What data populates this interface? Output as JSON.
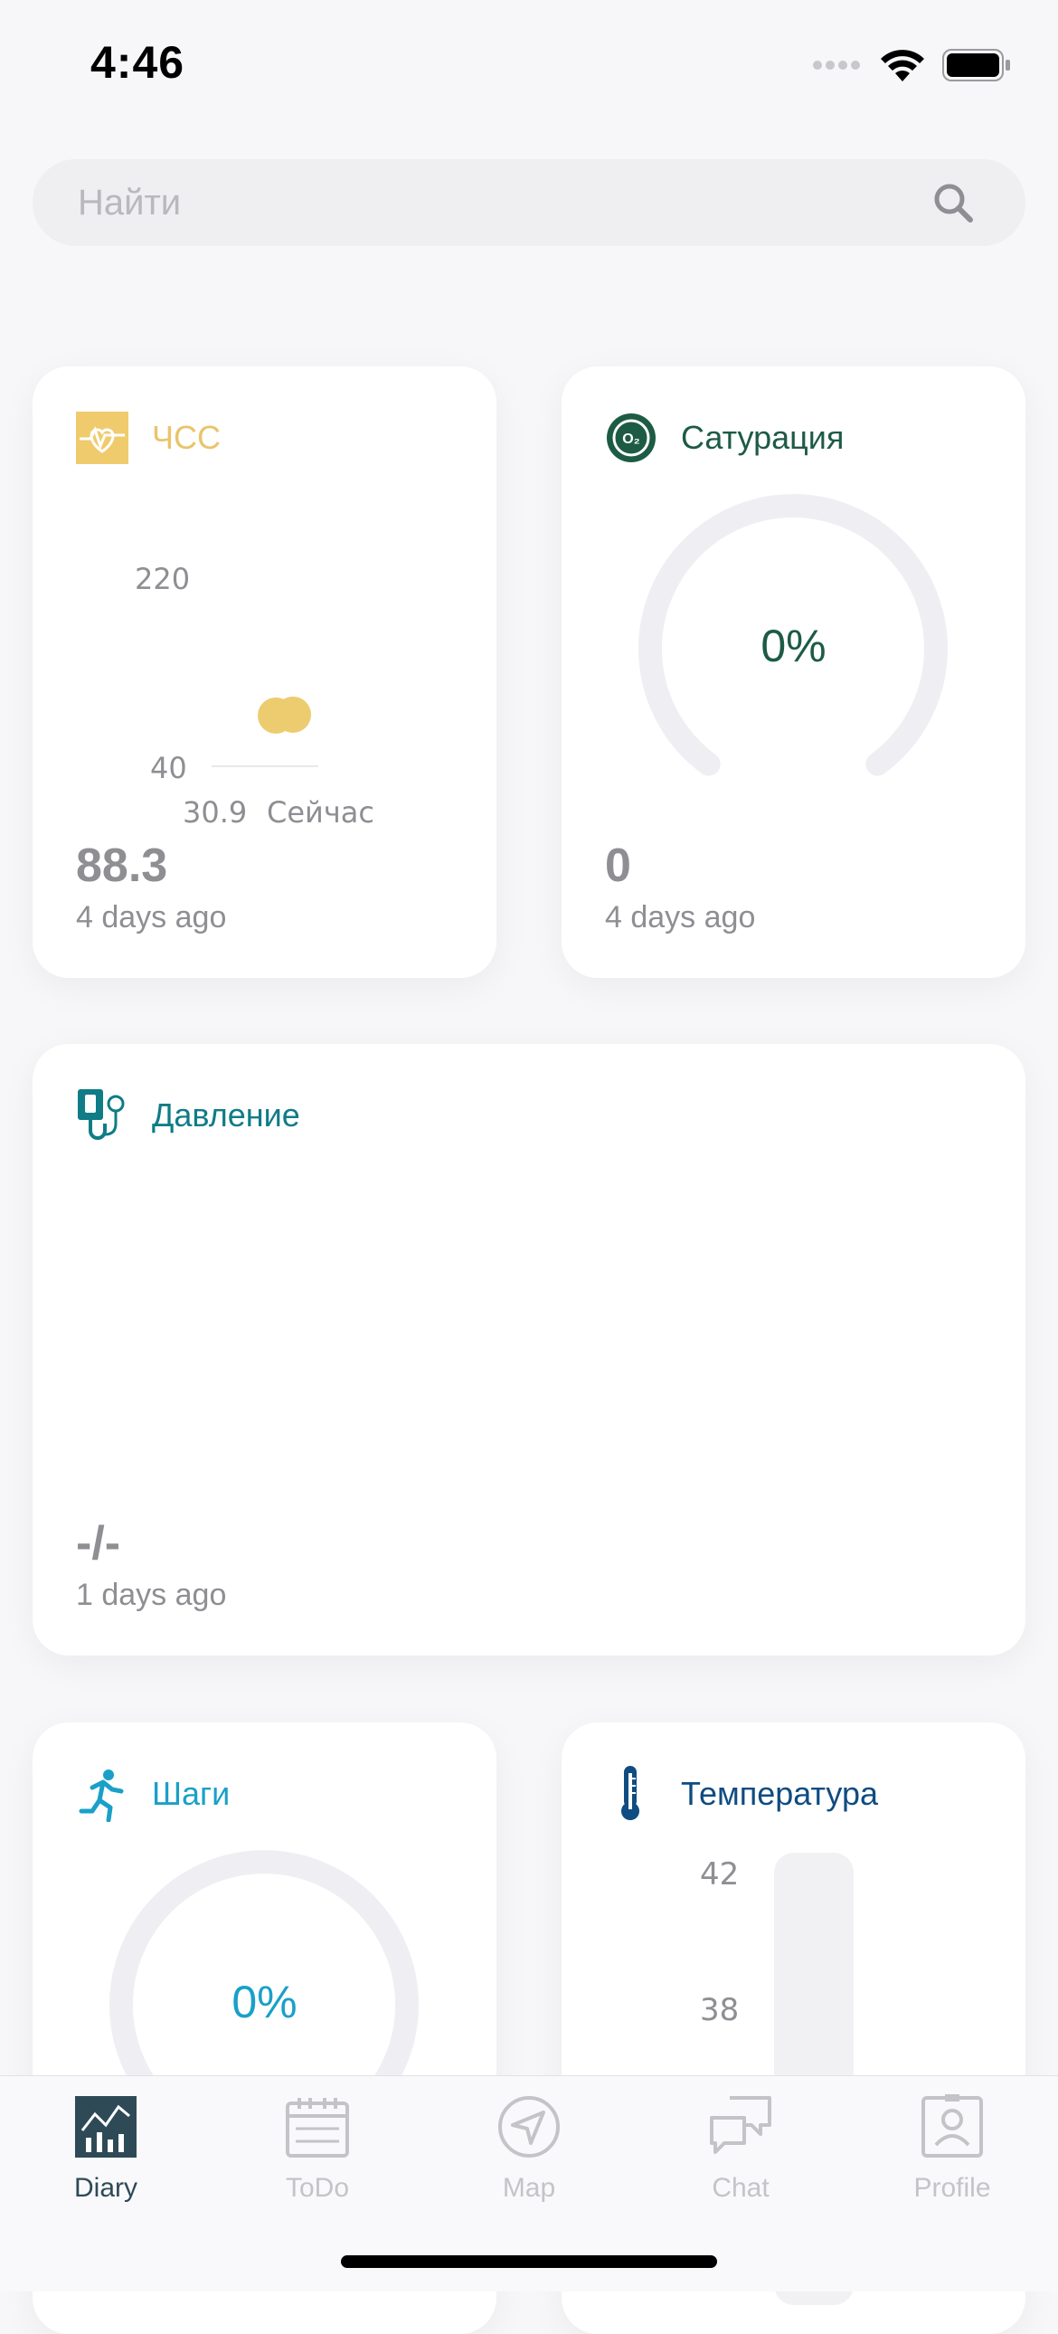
{
  "status_bar": {
    "time": "4:46"
  },
  "search": {
    "placeholder": "Найти"
  },
  "cards": {
    "hr": {
      "title": "ЧСС",
      "value": "88.3",
      "ago": "4 days ago",
      "axis_max": "220",
      "axis_min": "40",
      "x_labels": [
        "30.9",
        "Сейчас"
      ],
      "color": "#e9c46a"
    },
    "saturation": {
      "title": "Сатурация",
      "gauge_label": "0%",
      "value": "0",
      "ago": "4 days ago",
      "gauge_fraction": 0,
      "color": "#1d5b45"
    },
    "pressure": {
      "title": "Давление",
      "value": "-/-",
      "ago": "1 days ago",
      "color": "#0f7c86"
    },
    "steps": {
      "title": "Шаги",
      "gauge_label": "0%",
      "gauge_fraction": 0,
      "color": "#1aa0c8"
    },
    "temperature": {
      "title": "Температура",
      "axis_labels": [
        "42",
        "38"
      ],
      "color": "#0f4c81"
    }
  },
  "tabbar": {
    "tabs": [
      {
        "label": "Diary",
        "active": true
      },
      {
        "label": "ToDo",
        "active": false
      },
      {
        "label": "Map",
        "active": false
      },
      {
        "label": "Chat",
        "active": false
      },
      {
        "label": "Profile",
        "active": false
      }
    ],
    "active_color": "#2e4a57",
    "inactive_color": "#c4c4c8"
  }
}
